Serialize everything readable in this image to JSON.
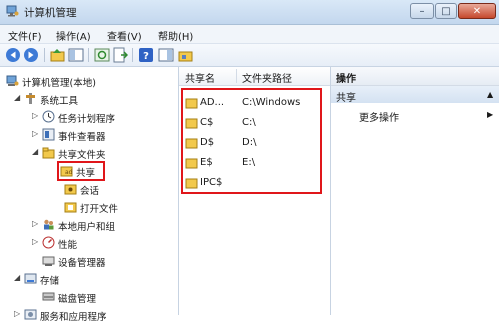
{
  "window": {
    "title": "计算机管理",
    "buttons": {
      "minimize": "–",
      "maximize": "□",
      "close": "✕"
    }
  },
  "menu": [
    "文件(F)",
    "操作(A)",
    "查看(V)",
    "帮助(H)"
  ],
  "tree": [
    {
      "label": "计算机管理(本地)",
      "expand": "",
      "icon": "computer-management-icon"
    },
    {
      "label": "系统工具",
      "expand": "◢",
      "icon": "tools-icon"
    },
    {
      "label": "任务计划程序",
      "expand": "▷",
      "icon": "clock-icon"
    },
    {
      "label": "事件查看器",
      "expand": "▷",
      "icon": "event-viewer-icon"
    },
    {
      "label": "共享文件夹",
      "expand": "◢",
      "icon": "shared-folder-icon"
    },
    {
      "label": "共享",
      "expand": "",
      "icon": "share-icon",
      "selected": true
    },
    {
      "label": "会话",
      "expand": "",
      "icon": "sessions-icon"
    },
    {
      "label": "打开文件",
      "expand": "",
      "icon": "open-files-icon"
    },
    {
      "label": "本地用户和组",
      "expand": "▷",
      "icon": "users-icon"
    },
    {
      "label": "性能",
      "expand": "▷",
      "icon": "performance-icon"
    },
    {
      "label": "设备管理器",
      "expand": "",
      "icon": "device-manager-icon"
    },
    {
      "label": "存储",
      "expand": "◢",
      "icon": "storage-icon"
    },
    {
      "label": "磁盘管理",
      "expand": "",
      "icon": "disk-icon"
    },
    {
      "label": "服务和应用程序",
      "expand": "▷",
      "icon": "services-icon"
    }
  ],
  "list": {
    "headers": {
      "name": "共享名",
      "path": "文件夹路径"
    },
    "rows": [
      {
        "name": "AD...",
        "path": "C:\\Windows"
      },
      {
        "name": "C$",
        "path": "C:\\"
      },
      {
        "name": "D$",
        "path": "D:\\"
      },
      {
        "name": "E$",
        "path": "E:\\"
      },
      {
        "name": "IPC$",
        "path": ""
      }
    ]
  },
  "actions": {
    "header": "操作",
    "section": "共享",
    "section_arrow": "▲",
    "more": "更多操作",
    "more_arrow": "▶"
  },
  "colors": {
    "highlight_red": "#e0161a",
    "folder_yellow": "#f2c94c"
  }
}
